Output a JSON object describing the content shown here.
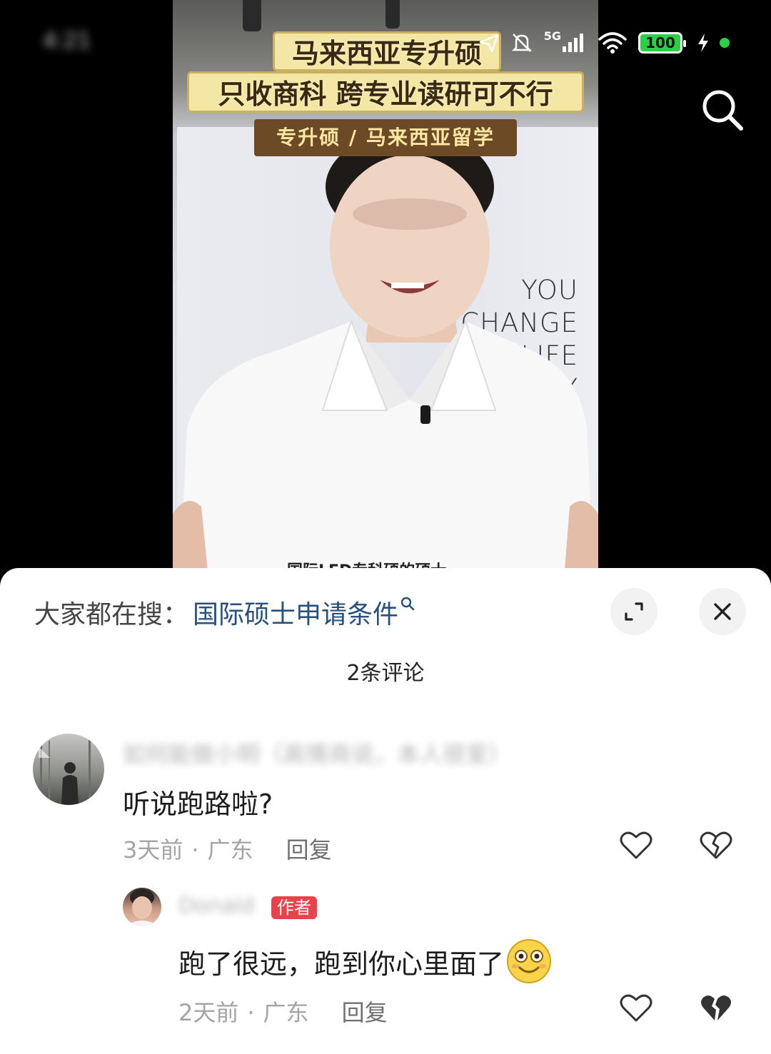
{
  "status_bar": {
    "time": "4:21",
    "network": "5G",
    "battery": "100"
  },
  "video": {
    "title_line1": "马来西亚专升硕",
    "title_line2": "只收商科 跨专业读研可不行",
    "tag": "专升硕 / 马来西亚留学",
    "wall_text": [
      "YOU",
      "CHANGE",
      "OUR LIFE",
      "BY"
    ],
    "subtitle_peek": "国际LED专科硕的硕士"
  },
  "sheet": {
    "trending_label": "大家都在搜：",
    "trending_query": "国际硕士申请条件",
    "comment_count": "2条评论"
  },
  "comments": [
    {
      "username": "如何能做小明（高情商说，本人很爱）",
      "text": "听说跑路啦?",
      "time": "3天前",
      "location": "广东",
      "reply_label": "回复"
    },
    {
      "username": "Donald",
      "badge": "作者",
      "text": "跑了很远，跑到你心里面了",
      "time": "2天前",
      "location": "广东",
      "reply_label": "回复"
    }
  ],
  "meta_separator": "·",
  "icons": {
    "search": "search-icon",
    "expand": "expand-icon",
    "close": "close-icon",
    "like": "heart-outline-icon",
    "dislike": "broken-heart-icon",
    "emoji": "smile-emoji-icon"
  },
  "colors": {
    "link_blue": "#26507d",
    "author_badge": "#e8424c",
    "battery_green": "#2bd144"
  }
}
